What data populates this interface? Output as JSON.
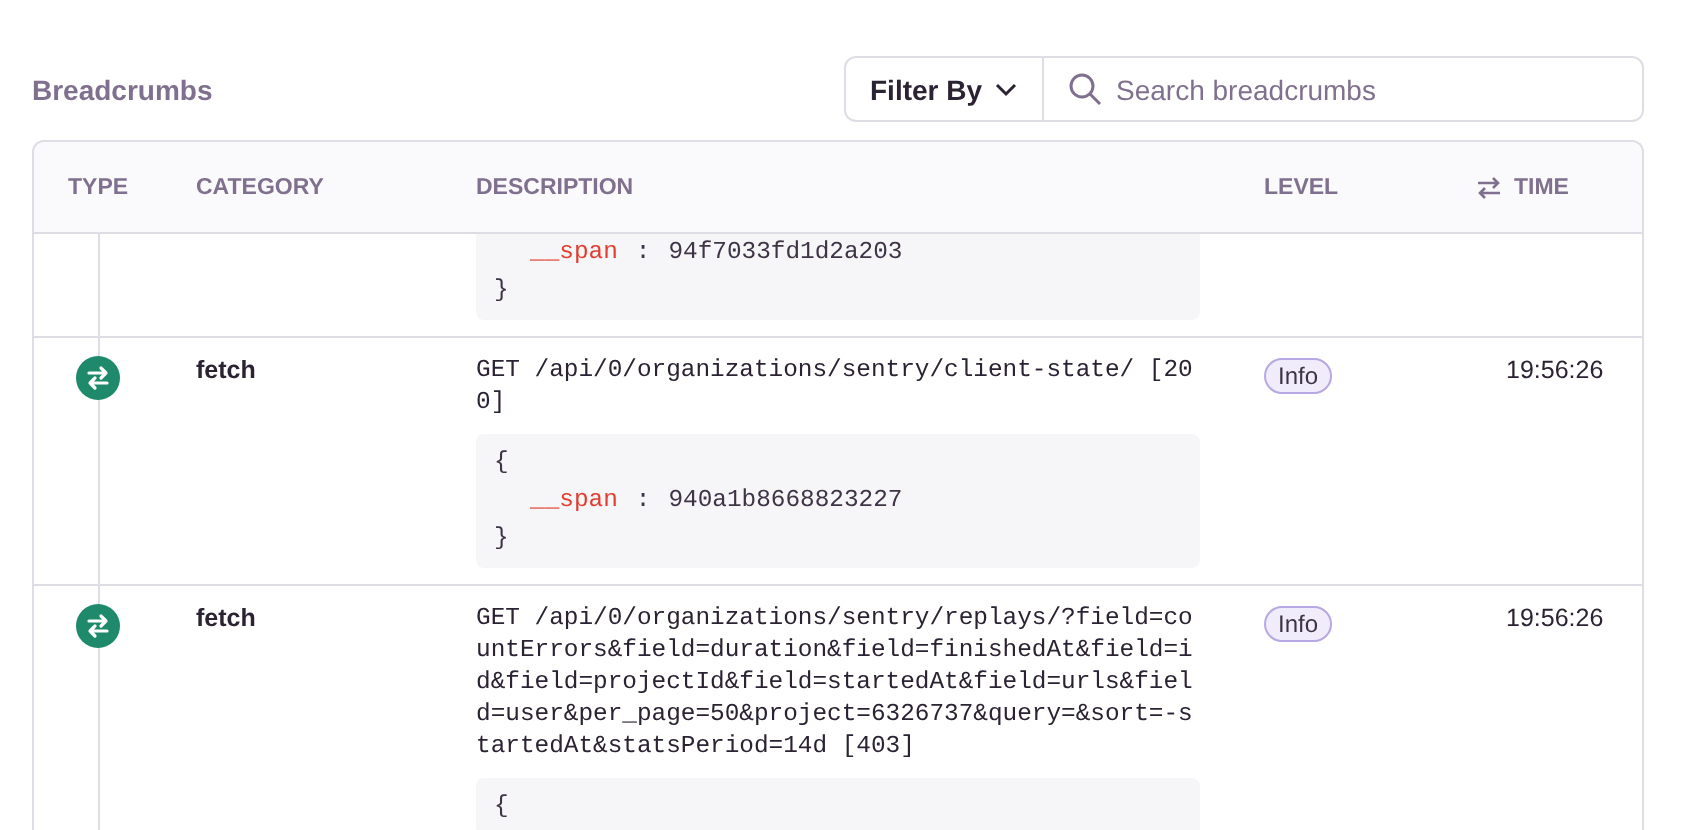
{
  "title": "Breadcrumbs",
  "filter": {
    "label": "Filter By",
    "placeholder": "Search breadcrumbs"
  },
  "columns": [
    {
      "label": "TYPE",
      "kind": "plain"
    },
    {
      "label": "CATEGORY",
      "kind": "plain"
    },
    {
      "label": "DESCRIPTION",
      "kind": "plain"
    },
    {
      "label": "LEVEL",
      "kind": "plain"
    },
    {
      "label": "TIME",
      "kind": "sortable"
    }
  ],
  "rows": [
    {
      "code": [
        {
          "kind": "field",
          "key": "__span",
          "separator": ":",
          "value": "94f7033fd1d2a203"
        },
        {
          "kind": "brace",
          "text": "}"
        }
      ]
    },
    {
      "category": "fetch",
      "description": "GET /api/0/organizations/sentry/client-state/ [200]",
      "level": "Info",
      "time": "19:56:26",
      "code": [
        {
          "kind": "brace",
          "text": "{"
        },
        {
          "kind": "field",
          "key": "__span",
          "separator": ":",
          "value": "940a1b8668823227"
        },
        {
          "kind": "brace",
          "text": "}"
        }
      ]
    },
    {
      "category": "fetch",
      "description": "GET /api/0/organizations/sentry/replays/?field=countErrors&field=duration&field=finishedAt&field=id&field=projectId&field=startedAt&field=urls&field=user&per_page=50&project=6326737&query=&sort=-startedAt&statsPeriod=14d [403]",
      "level": "Info",
      "time": "19:56:26",
      "code": [
        {
          "kind": "brace",
          "text": "{"
        }
      ]
    }
  ]
}
